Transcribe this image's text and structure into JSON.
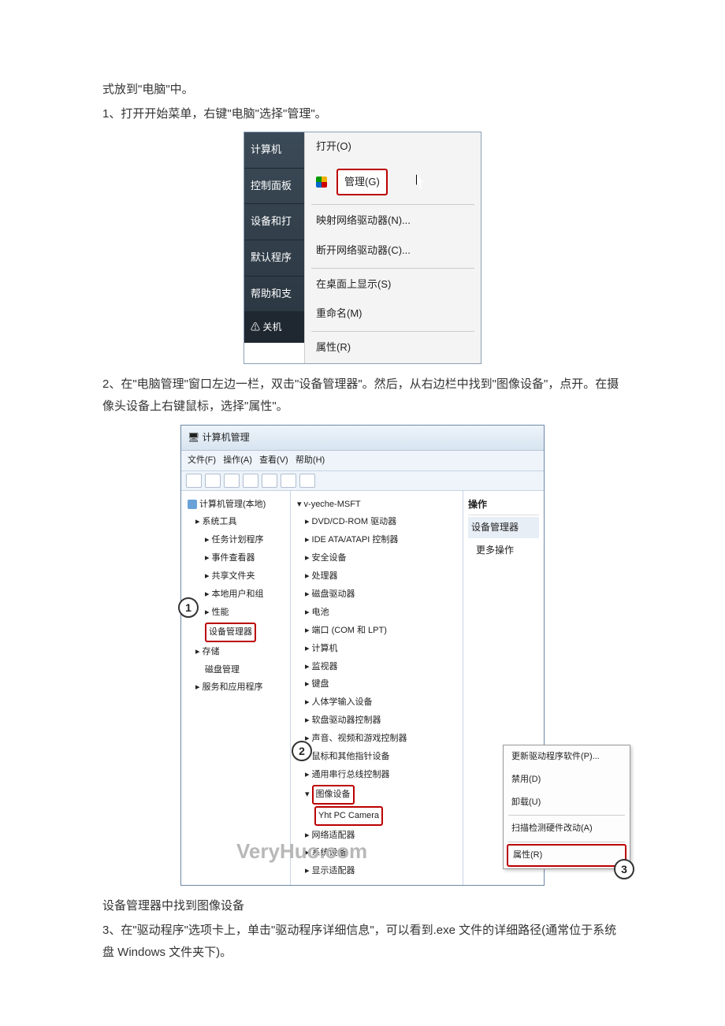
{
  "text": {
    "p0": "式放到\"电脑\"中。",
    "p1": "1、打开开始菜单，右键\"电脑\"选择\"管理\"。",
    "p2": "2、在\"电脑管理\"窗口左边一栏，双击\"设备管理器\"。然后，从右边栏中找到\"图像设备\"，点开。在摄像头设备上右键鼠标，选择\"属性\"。",
    "p3": "设备管理器中找到图像设备",
    "p4": "3、在\"驱动程序\"选项卡上，单击\"驱动程序详细信息\"，可以看到.exe 文件的详细路径(通常位于系统盘 Windows 文件夹下)。"
  },
  "fig1": {
    "start": {
      "computer": "计算机",
      "control": "控制面板",
      "devices": "设备和打",
      "default": "默认程序",
      "help": "帮助和支",
      "shutdown": "关机"
    },
    "menu": {
      "open": "打开(O)",
      "manage": "管理(G)",
      "mapDrive": "映射网络驱动器(N)...",
      "disconnect": "断开网络驱动器(C)...",
      "showDesktop": "在桌面上显示(S)",
      "rename": "重命名(M)",
      "properties": "属性(R)"
    }
  },
  "fig2": {
    "title": "计算机管理",
    "menus": {
      "file": "文件(F)",
      "action": "操作(A)",
      "view": "查看(V)",
      "help": "帮助(H)"
    },
    "left": {
      "root": "计算机管理(本地)",
      "sysTools": "系统工具",
      "taskSched": "任务计划程序",
      "eventViewer": "事件查看器",
      "sharedFolders": "共享文件夹",
      "localUsers": "本地用户和组",
      "perf": "性能",
      "devMgr": "设备管理器",
      "storage": "存储",
      "diskMgmt": "磁盘管理",
      "services": "服务和应用程序"
    },
    "mid": {
      "host": "v-yeche-MSFT",
      "dvd": "DVD/CD-ROM 驱动器",
      "ide": "IDE ATA/ATAPI 控制器",
      "security": "安全设备",
      "cpu": "处理器",
      "disk": "磁盘驱动器",
      "battery": "电池",
      "ports": "端口 (COM 和 LPT)",
      "computer": "计算机",
      "monitor": "监视器",
      "keyboard": "键盘",
      "hid": "人体学输入设备",
      "floppy": "软盘驱动器控制器",
      "sound": "声音、视频和游戏控制器",
      "mouse": "鼠标和其他指针设备",
      "usb": "通用串行总线控制器",
      "imaging": "图像设备",
      "camera": "Yht PC Camera",
      "netAdapters": "网络适配器",
      "sysDevices": "系统设备",
      "display": "显示适配器"
    },
    "right": {
      "ops": "操作",
      "devMgr": "设备管理器",
      "more": "更多操作"
    },
    "ctx": {
      "update": "更新驱动程序软件(P)...",
      "disable": "禁用(D)",
      "uninstall": "卸载(U)",
      "scan": "扫描检测硬件改动(A)",
      "properties": "属性(R)"
    },
    "marks": {
      "n1": "1",
      "n2": "2",
      "n3": "3"
    },
    "watermark": "VeryHuo.com"
  }
}
